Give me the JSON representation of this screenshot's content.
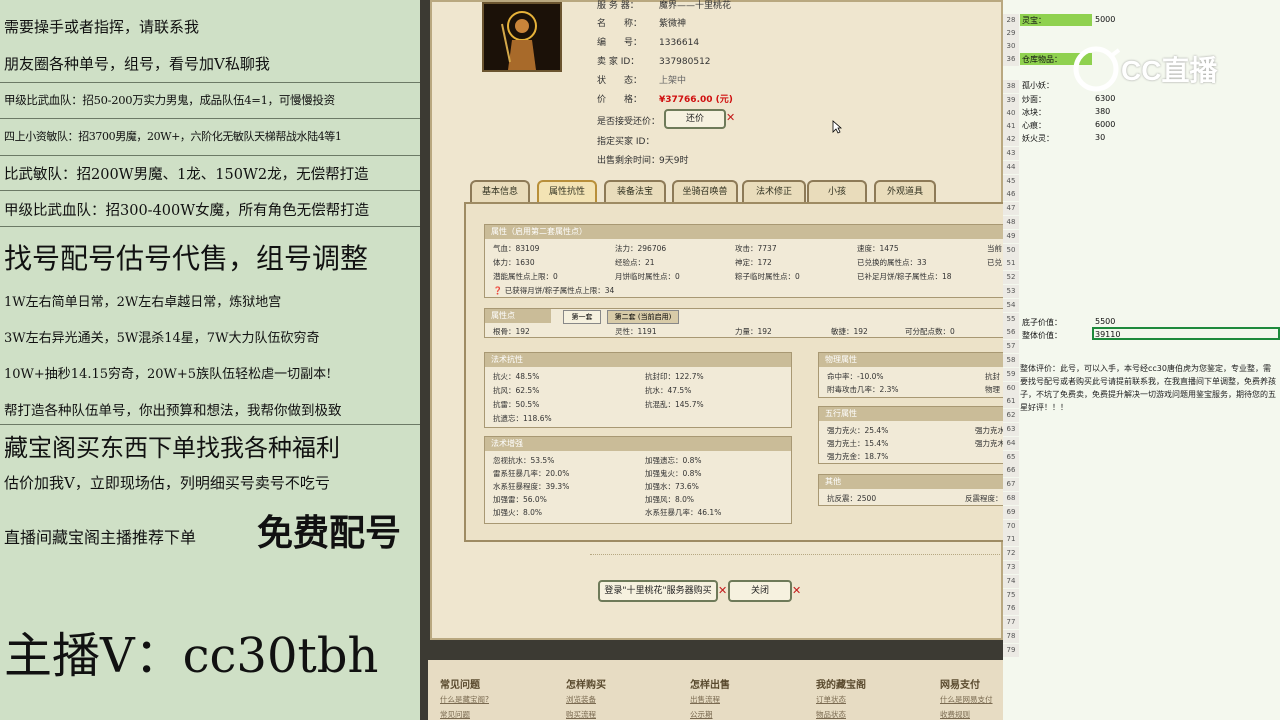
{
  "left": {
    "lines": [
      "需要操手或者指挥，请联系我",
      "朋友圈各种单号，组号，看号加V私聊我",
      "甲级比武血队：招50-200万实力男鬼，成品队伍4=1，可慢慢投资",
      "四上小资敏队：招3700男魔，20W+，六阶化无敏队天梯帮战水陆4等1",
      "比武敏队：招200W男魔、1龙、150W2龙，无偿帮打造",
      "甲级比武血队：招300-400W女魔，所有角色无偿帮打造",
      "找号配号估号代售，组号调整",
      "1W左右简单日常，2W左右卓越日常，炼狱地宫",
      "3W左右异光通关，5W混杀14星，7W大力队伍砍穷奇",
      "10W+抽秒14.15穷奇，20W+5族队伍轻松虐一切副本!",
      "帮打造各种队伍单号，你出预算和想法，我帮你做到极致",
      "藏宝阁买东西下单找我各种福利",
      "估价加我V，立即现场估，列明细买号卖号不吃亏",
      "直播间藏宝阁主播推荐下单",
      "免费配号",
      "主播V：cc30tbh"
    ]
  },
  "game": {
    "server_label": "服 务 器：",
    "server_value": "魔界——十里桃花",
    "name_label": "名　　称：",
    "name_value": "紫微神",
    "id_label": "编　　号：",
    "id_value": "1336614",
    "seller_label": "卖 家 ID：",
    "seller_value": "337980512",
    "status_label": "状　　态：",
    "status_value": "上架中",
    "price_label": "价　　格：",
    "price_value": "¥37766.00 (元)",
    "counter_label": "是否接受还价：",
    "counter_btn": "还价",
    "buyer_label": "指定买家 ID：",
    "time_label": "出售剩余时间：",
    "time_value": "9天9时",
    "tabs": [
      "基本信息",
      "属性抗性",
      "装备法宝",
      "坐骑召唤兽",
      "法术修正",
      "小孩",
      "外观道具"
    ],
    "attr_header": "属性（启用第二套属性点）",
    "attr_rows": [
      [
        "气血：83109",
        "法力：296706",
        "攻击：7737",
        "速度：1475",
        "当前"
      ],
      [
        "体力：1630",
        "经验点：21",
        "神定：172",
        "已兑换的属性点：33",
        "已兑"
      ],
      [
        "潜能属性点上限：0",
        "月饼临时属性点：0",
        "粽子临时属性点：0",
        "已补足月饼/粽子属性点：18",
        ""
      ]
    ],
    "attr_note": "已获得月饼/粽子属性点上限：34",
    "points_header": "属性点",
    "points_tab1": "第一套",
    "points_tab2": "第二套 (当前启用)",
    "points_row": [
      "根骨：192",
      "灵性：1191",
      "力量：192",
      "敏捷：192",
      "可分配点数：0"
    ],
    "resist_header": "法术抗性",
    "resist_rows": [
      [
        "抗火：48.5%",
        "抗封印：122.7%"
      ],
      [
        "抗风：62.5%",
        "抗水：47.5%"
      ],
      [
        "抗雷：50.5%",
        "抗混乱：145.7%"
      ],
      [
        "抗遗忘：118.6%",
        ""
      ]
    ],
    "boost_header": "法术增强",
    "boost_rows": [
      [
        "忽视抗水：53.5%",
        "加强遗忘：0.8%"
      ],
      [
        "雷系狂暴几率：20.0%",
        "加强鬼火：0.8%"
      ],
      [
        "水系狂暴程度：39.3%",
        "加强水：73.6%"
      ],
      [
        "加强雷：56.0%",
        "加强风：8.0%"
      ],
      [
        "加强火：8.0%",
        "水系狂暴几率：46.1%"
      ]
    ],
    "phys_header": "物理属性",
    "phys_rows": [
      [
        "命中率：-10.0%",
        "抗封"
      ],
      [
        "附毒攻击几率：2.3%",
        "物理"
      ]
    ],
    "wuxing_header": "五行属性",
    "wuxing_rows": [
      [
        "强力克火：25.4%",
        "强力克水"
      ],
      [
        "强力克土：15.4%",
        "强力克木"
      ],
      [
        "强力克金：18.7%",
        ""
      ]
    ],
    "other_header": "其他",
    "other_rows": [
      [
        "抗反震：2500",
        "反震程度："
      ]
    ],
    "login_btn": "登录\"十里桃花\"服务器购买",
    "close_btn": "关闭"
  },
  "footer": {
    "cols": [
      {
        "title": "常见问题",
        "links": [
          "什么是藏宝阁?",
          "常见问题"
        ]
      },
      {
        "title": "怎样购买",
        "links": [
          "浏览装备",
          "购买流程"
        ]
      },
      {
        "title": "怎样出售",
        "links": [
          "出售流程",
          "公示期"
        ]
      },
      {
        "title": "我的藏宝阁",
        "links": [
          "订单状态",
          "物品状态"
        ]
      },
      {
        "title": "网易支付",
        "links": [
          "什么是网易支付",
          "收费规则"
        ]
      }
    ]
  },
  "sheet": {
    "watermark": "CC直播",
    "rows": [
      {
        "n": "28",
        "a": "灵宝：",
        "b": "5000",
        "green": true
      },
      {
        "n": "29",
        "a": "",
        "b": ""
      },
      {
        "n": "30",
        "a": "",
        "b": ""
      },
      {
        "n": "36",
        "a": "仓库物品：",
        "b": "",
        "green": true
      },
      {
        "n": "38",
        "a": "孤小妖：",
        "b": "",
        "green": false
      },
      {
        "n": "39",
        "a": "炒面：",
        "b": "6300"
      },
      {
        "n": "40",
        "a": "冰块：",
        "b": "380"
      },
      {
        "n": "41",
        "a": "心痕：",
        "b": "6000"
      },
      {
        "n": "42",
        "a": "妖火灵：",
        "b": "30"
      }
    ],
    "row_numbers": [
      "43",
      "44",
      "45",
      "46",
      "47",
      "48",
      "49",
      "50",
      "51",
      "52",
      "53",
      "54",
      "55",
      "56",
      "57",
      "58",
      "59",
      "60",
      "61",
      "62",
      "63",
      "64",
      "65",
      "66",
      "67",
      "68",
      "69",
      "70",
      "71",
      "72",
      "73",
      "74",
      "75",
      "76",
      "77",
      "78",
      "79"
    ],
    "base_label": "底子价值：",
    "base_value": "5500",
    "total_label": "整体价值：",
    "total_value": "39110",
    "comment": "整体评价：此号，可以入手，本号经cc30唐伯虎为您鉴定，专业整，需要找号配号或者购买此号请提前联系我，在我直播间下单调整，免费养孩子，不坑了免费卖，免费提升解决一切游戏问题用鉴宝服务，期待您的五星好评！！！"
  }
}
